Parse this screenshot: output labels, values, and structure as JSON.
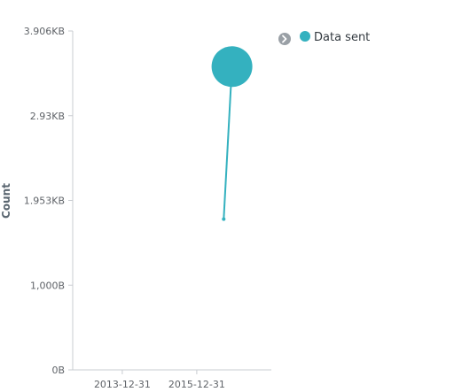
{
  "chart_data": {
    "type": "line",
    "ylabel": "Count",
    "xlabel": "",
    "y_ticks": [
      {
        "value": 0,
        "label": "0B"
      },
      {
        "value": 1000,
        "label": "1,000B"
      },
      {
        "value": 2000,
        "label": "1.953KB"
      },
      {
        "value": 3000,
        "label": "2.93KB"
      },
      {
        "value": 4000,
        "label": "3.906KB"
      }
    ],
    "ylim": [
      0,
      4000
    ],
    "x_ticks": [
      {
        "value": "2013-12-31",
        "label": "2013-12-31"
      },
      {
        "value": "2015-12-31",
        "label": "2015-12-31"
      }
    ],
    "xlim": [
      "2012-09-01",
      "2017-12-31"
    ],
    "series": [
      {
        "name": "Data sent",
        "color": "#34b1bf",
        "points": [
          {
            "x": "2016-09-20",
            "y": 1780
          },
          {
            "x": "2016-12-10",
            "y": 3580
          }
        ]
      }
    ],
    "point_style": "bubble",
    "legend": {
      "position": "top-right",
      "entries": [
        "Data sent"
      ],
      "toggle_icon": "chevron-right-icon"
    },
    "grid": false
  }
}
